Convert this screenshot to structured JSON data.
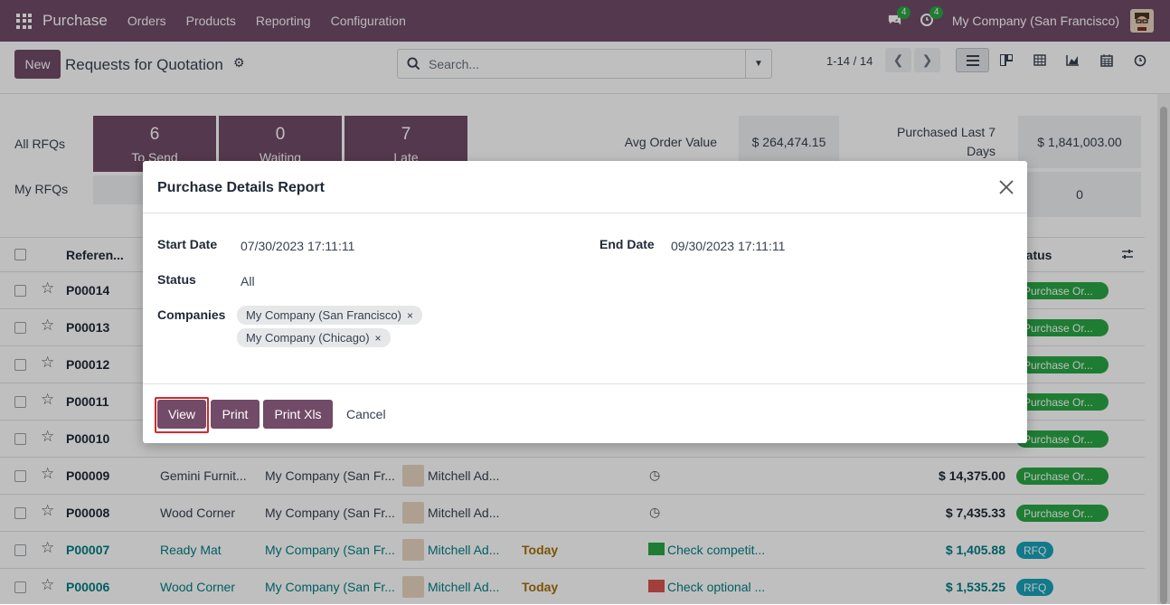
{
  "topbar": {
    "app": "Purchase",
    "menus": [
      "Orders",
      "Products",
      "Reporting",
      "Configuration"
    ],
    "messages_badge": "4",
    "activity_badge": "4",
    "company": "My Company (San Francisco)"
  },
  "control": {
    "new_label": "New",
    "title": "Requests for Quotation",
    "search_placeholder": "Search...",
    "pager": "1-14 / 14"
  },
  "dashboard": {
    "row1_label": "All RFQs",
    "row2_label": "My RFQs",
    "tiles": [
      {
        "n": "6",
        "t": "To Send"
      },
      {
        "n": "0",
        "t": "Waiting"
      },
      {
        "n": "7",
        "t": "Late"
      }
    ],
    "avg_label": "Avg Order Value",
    "avg_value": "$ 264,474.15",
    "purchased_label1": "Purchased Last 7",
    "purchased_label2": "Days",
    "purchased_value": "$ 1,841,003.00",
    "myrfq_value": "0"
  },
  "list": {
    "header_ref": "Referen...",
    "header_status": "tatus",
    "rows": [
      {
        "ref": "P00014",
        "vendor": "",
        "company": "",
        "buyer": "",
        "date": "",
        "activity": "",
        "total": "",
        "status": "Purchase Or...",
        "kind": "po"
      },
      {
        "ref": "P00013",
        "vendor": "",
        "company": "",
        "buyer": "",
        "date": "",
        "activity": "",
        "total": "",
        "status": "Purchase Or...",
        "kind": "po"
      },
      {
        "ref": "P00012",
        "vendor": "",
        "company": "",
        "buyer": "",
        "date": "",
        "activity": "",
        "total": "",
        "status": "Purchase Or...",
        "kind": "po"
      },
      {
        "ref": "P00011",
        "vendor": "",
        "company": "",
        "buyer": "",
        "date": "",
        "activity": "",
        "total": "",
        "status": "Purchase Or...",
        "kind": "po"
      },
      {
        "ref": "P00010",
        "vendor": "",
        "company": "",
        "buyer": "",
        "date": "",
        "activity": "",
        "total": "",
        "status": "Purchase Or...",
        "kind": "po"
      },
      {
        "ref": "P00009",
        "vendor": "Gemini Furnit...",
        "company": "My Company (San Fr...",
        "buyer": "Mitchell Ad...",
        "date": "",
        "activity": "",
        "total": "$ 14,375.00",
        "status": "Purchase Or...",
        "kind": "po"
      },
      {
        "ref": "P00008",
        "vendor": "Wood Corner",
        "company": "My Company (San Fr...",
        "buyer": "Mitchell Ad...",
        "date": "",
        "activity": "",
        "total": "$ 7,435.33",
        "status": "Purchase Or...",
        "kind": "po"
      },
      {
        "ref": "P00007",
        "vendor": "Ready Mat",
        "company": "My Company (San Fr...",
        "buyer": "Mitchell Ad...",
        "date": "Today",
        "activity": "Check competit...",
        "total": "$ 1,405.88",
        "status": "RFQ",
        "kind": "rfq"
      },
      {
        "ref": "P00006",
        "vendor": "Wood Corner",
        "company": "My Company (San Fr...",
        "buyer": "Mitchell Ad...",
        "date": "Today",
        "activity": "Check optional ...",
        "total": "$ 1,535.25",
        "status": "RFQ",
        "kind": "rfq"
      }
    ]
  },
  "modal": {
    "title": "Purchase Details Report",
    "start_label": "Start Date",
    "start_value": "07/30/2023 17:11:11",
    "end_label": "End Date",
    "end_value": "09/30/2023 17:11:11",
    "status_label": "Status",
    "status_value": "All",
    "companies_label": "Companies",
    "companies": [
      "My Company (San Francisco)",
      "My Company (Chicago)"
    ],
    "btn_view": "View",
    "btn_print": "Print",
    "btn_print_xls": "Print Xls",
    "btn_cancel": "Cancel"
  },
  "colors": {
    "brand": "#714b67",
    "po_green": "#28a745",
    "rfq_blue": "#17a2b8",
    "highlight": "#d62828"
  }
}
